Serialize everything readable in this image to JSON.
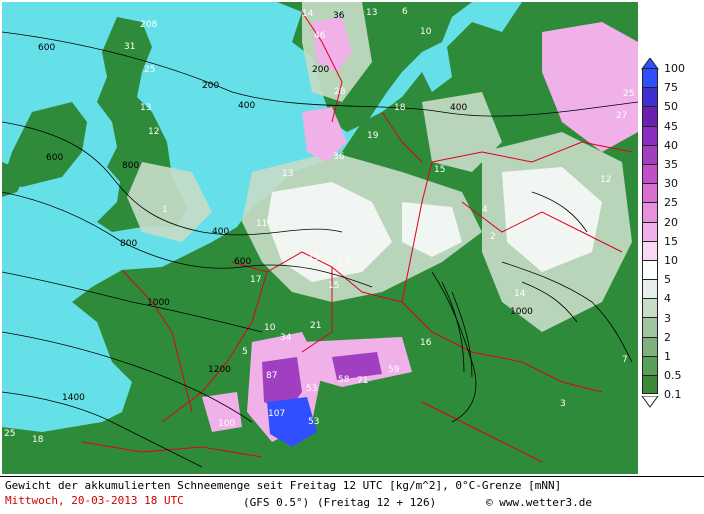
{
  "caption": {
    "line1": "Gewicht der akkumulierten Schneemenge seit Freitag 12 UTC [kg/m^2], 0°C-Grenze [mNN]",
    "valid_time": "Mittwoch, 20-03-2013  18 UTC",
    "model": "(GFS 0.5°)",
    "run": "(Freitag 12 + 126)",
    "copyright": "© www.wetter3.de"
  },
  "legend": {
    "labels": [
      "100",
      "75",
      "50",
      "45",
      "40",
      "35",
      "30",
      "25",
      "20",
      "15",
      "10",
      "5",
      "4",
      "3",
      "2",
      "1",
      "0.5",
      "0.1"
    ],
    "colors": [
      "#3050ff",
      "#4030d0",
      "#6a20b0",
      "#8a30c0",
      "#a040c0",
      "#c050c8",
      "#d870d0",
      "#e890dc",
      "#f0b0e8",
      "#f8d8f4",
      "#ffffff",
      "#e8efe8",
      "#c8dcc8",
      "#a0c4a0",
      "#80b080",
      "#58a058",
      "#3a8a3a"
    ],
    "colors_meaning": "snow amount color scale"
  },
  "colors": {
    "sea": "#66e0e8",
    "land": "#2e8b3a",
    "borders": "#e0001a",
    "contours": "#000000"
  },
  "snow_values": [
    {
      "v": "14"
    },
    {
      "v": "36"
    },
    {
      "v": "13"
    },
    {
      "v": "6"
    },
    {
      "v": "10"
    },
    {
      "v": "208"
    },
    {
      "v": "46"
    },
    {
      "v": "31"
    },
    {
      "v": "25"
    },
    {
      "v": "28"
    },
    {
      "v": "18"
    },
    {
      "v": "13"
    },
    {
      "v": "12"
    },
    {
      "v": "27"
    },
    {
      "v": "25"
    },
    {
      "v": "19"
    },
    {
      "v": "36"
    },
    {
      "v": "13"
    },
    {
      "v": "15"
    },
    {
      "v": "12"
    },
    {
      "v": "17"
    },
    {
      "v": "11"
    },
    {
      "v": "19"
    },
    {
      "v": "17"
    },
    {
      "v": "15"
    },
    {
      "v": "16"
    },
    {
      "v": "34"
    },
    {
      "v": "21"
    },
    {
      "v": "87"
    },
    {
      "v": "53"
    },
    {
      "v": "58"
    },
    {
      "v": "71"
    },
    {
      "v": "59"
    },
    {
      "v": "107"
    },
    {
      "v": "100"
    },
    {
      "v": "53"
    },
    {
      "v": "18"
    },
    {
      "v": "25"
    },
    {
      "v": "14"
    },
    {
      "v": "7"
    },
    {
      "v": "10"
    },
    {
      "v": "5"
    },
    {
      "v": "2"
    },
    {
      "v": "3"
    },
    {
      "v": "4"
    },
    {
      "v": "1"
    }
  ],
  "contour_labels": [
    {
      "v": "600"
    },
    {
      "v": "200"
    },
    {
      "v": "200"
    },
    {
      "v": "400"
    },
    {
      "v": "400"
    },
    {
      "v": "600"
    },
    {
      "v": "800"
    },
    {
      "v": "1000"
    },
    {
      "v": "1200"
    },
    {
      "v": "1400"
    },
    {
      "v": "400"
    },
    {
      "v": "600"
    },
    {
      "v": "800"
    },
    {
      "v": "1000"
    }
  ]
}
